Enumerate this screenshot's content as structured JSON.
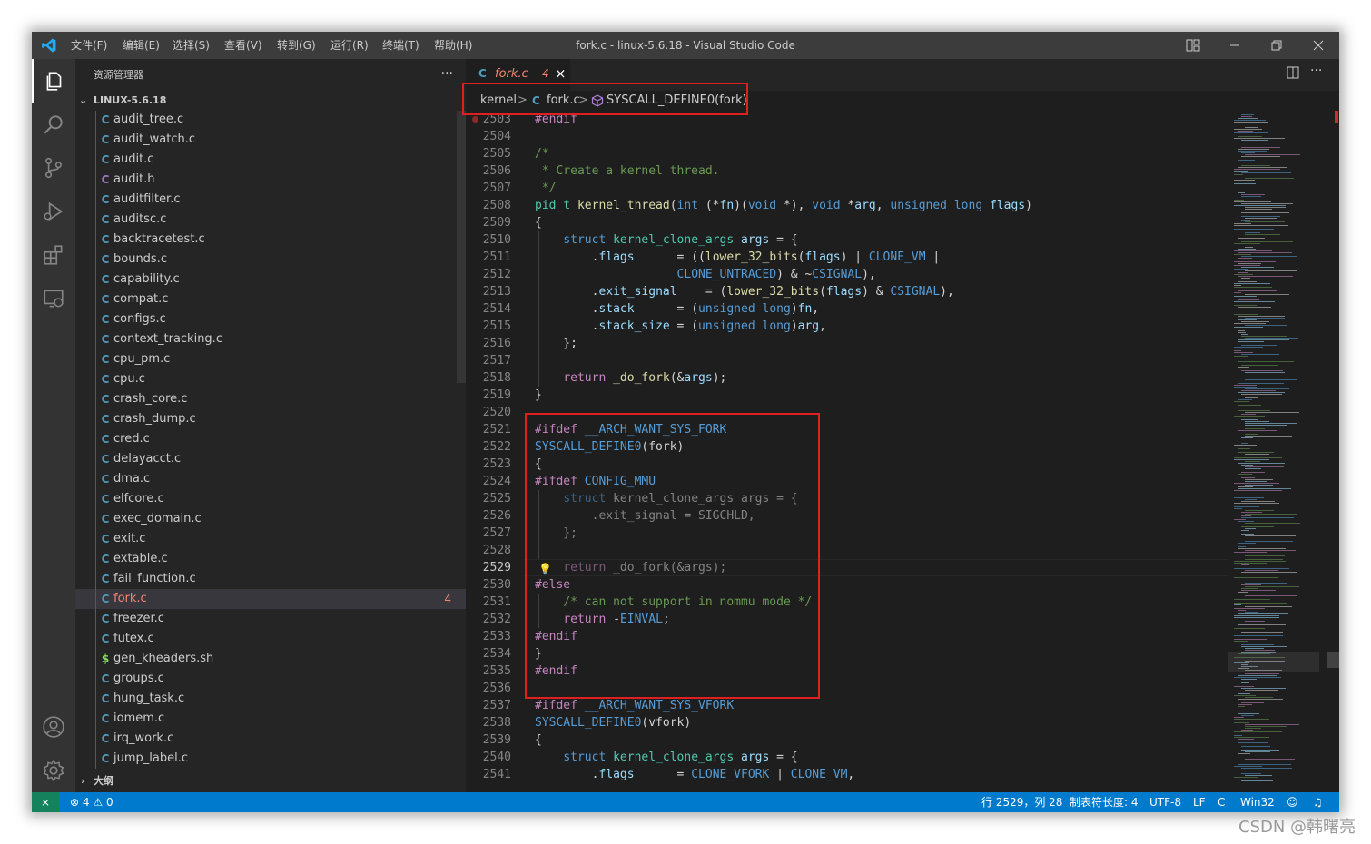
{
  "app": {
    "window_title": "fork.c - linux-5.6.18 - Visual Studio Code",
    "menu": [
      "文件(F)",
      "编辑(E)",
      "选择(S)",
      "查看(V)",
      "转到(G)",
      "运行(R)",
      "终端(T)",
      "帮助(H)"
    ]
  },
  "sidebar": {
    "title": "资源管理器",
    "more": "···",
    "section": "LINUX-5.6.18",
    "outline": "大纲",
    "files": [
      {
        "name": "audit_tree.c",
        "icon": "C",
        "color": "#519aba"
      },
      {
        "name": "audit_watch.c",
        "icon": "C",
        "color": "#519aba"
      },
      {
        "name": "audit.c",
        "icon": "C",
        "color": "#519aba"
      },
      {
        "name": "audit.h",
        "icon": "C",
        "color": "#a074c4"
      },
      {
        "name": "auditfilter.c",
        "icon": "C",
        "color": "#519aba"
      },
      {
        "name": "auditsc.c",
        "icon": "C",
        "color": "#519aba"
      },
      {
        "name": "backtracetest.c",
        "icon": "C",
        "color": "#519aba"
      },
      {
        "name": "bounds.c",
        "icon": "C",
        "color": "#519aba"
      },
      {
        "name": "capability.c",
        "icon": "C",
        "color": "#519aba"
      },
      {
        "name": "compat.c",
        "icon": "C",
        "color": "#519aba"
      },
      {
        "name": "configs.c",
        "icon": "C",
        "color": "#519aba"
      },
      {
        "name": "context_tracking.c",
        "icon": "C",
        "color": "#519aba"
      },
      {
        "name": "cpu_pm.c",
        "icon": "C",
        "color": "#519aba"
      },
      {
        "name": "cpu.c",
        "icon": "C",
        "color": "#519aba"
      },
      {
        "name": "crash_core.c",
        "icon": "C",
        "color": "#519aba"
      },
      {
        "name": "crash_dump.c",
        "icon": "C",
        "color": "#519aba"
      },
      {
        "name": "cred.c",
        "icon": "C",
        "color": "#519aba"
      },
      {
        "name": "delayacct.c",
        "icon": "C",
        "color": "#519aba"
      },
      {
        "name": "dma.c",
        "icon": "C",
        "color": "#519aba"
      },
      {
        "name": "elfcore.c",
        "icon": "C",
        "color": "#519aba"
      },
      {
        "name": "exec_domain.c",
        "icon": "C",
        "color": "#519aba"
      },
      {
        "name": "exit.c",
        "icon": "C",
        "color": "#519aba"
      },
      {
        "name": "extable.c",
        "icon": "C",
        "color": "#519aba"
      },
      {
        "name": "fail_function.c",
        "icon": "C",
        "color": "#519aba"
      },
      {
        "name": "fork.c",
        "icon": "C",
        "color": "#519aba",
        "active": true,
        "badge": "4"
      },
      {
        "name": "freezer.c",
        "icon": "C",
        "color": "#519aba"
      },
      {
        "name": "futex.c",
        "icon": "C",
        "color": "#519aba"
      },
      {
        "name": "gen_kheaders.sh",
        "icon": "$",
        "color": "#89e051"
      },
      {
        "name": "groups.c",
        "icon": "C",
        "color": "#519aba"
      },
      {
        "name": "hung_task.c",
        "icon": "C",
        "color": "#519aba"
      },
      {
        "name": "iomem.c",
        "icon": "C",
        "color": "#519aba"
      },
      {
        "name": "irq_work.c",
        "icon": "C",
        "color": "#519aba"
      },
      {
        "name": "jump_label.c",
        "icon": "C",
        "color": "#519aba"
      }
    ]
  },
  "tab": {
    "icon": "C",
    "name": "fork.c",
    "count": "4",
    "close": "×"
  },
  "breadcrumb": {
    "folder": "kernel",
    "sep": ">",
    "file_icon": "C",
    "file": "fork.c",
    "symbol": "SYSCALL_DEFINE0(fork)"
  },
  "code": [
    {
      "n": "2503",
      "dot": true,
      "s": [
        [
          "#endif",
          "p"
        ]
      ]
    },
    {
      "n": "2504",
      "s": []
    },
    {
      "n": "2505",
      "s": [
        [
          "/*",
          "c"
        ]
      ]
    },
    {
      "n": "2506",
      "s": [
        [
          " * Create a kernel thread.",
          "c"
        ]
      ]
    },
    {
      "n": "2507",
      "s": [
        [
          " */",
          "c"
        ]
      ]
    },
    {
      "n": "2508",
      "s": [
        [
          "pid_t",
          "t"
        ],
        [
          " ",
          "d"
        ],
        [
          "kernel_thread",
          "f"
        ],
        [
          "(",
          "d"
        ],
        [
          "int",
          "k"
        ],
        [
          " (*",
          "d"
        ],
        [
          "fn",
          "v"
        ],
        [
          ")(",
          "d"
        ],
        [
          "void",
          "k"
        ],
        [
          " *), ",
          "d"
        ],
        [
          "void",
          "k"
        ],
        [
          " *",
          "d"
        ],
        [
          "arg",
          "v"
        ],
        [
          ", ",
          "d"
        ],
        [
          "unsigned",
          "k"
        ],
        [
          " ",
          "d"
        ],
        [
          "long",
          "k"
        ],
        [
          " ",
          "d"
        ],
        [
          "flags",
          "v"
        ],
        [
          ")",
          "d"
        ]
      ]
    },
    {
      "n": "2509",
      "s": [
        [
          "{",
          "d"
        ]
      ]
    },
    {
      "n": "2510",
      "s": [
        [
          "    ",
          "d"
        ],
        [
          "struct",
          "k"
        ],
        [
          " ",
          "d"
        ],
        [
          "kernel_clone_args",
          "t"
        ],
        [
          " ",
          "d"
        ],
        [
          "args",
          "v"
        ],
        [
          " = {",
          "d"
        ]
      ]
    },
    {
      "n": "2511",
      "s": [
        [
          "        .",
          "d"
        ],
        [
          "flags",
          "v"
        ],
        [
          "      = ((",
          "d"
        ],
        [
          "lower_32_bits",
          "f"
        ],
        [
          "(",
          "d"
        ],
        [
          "flags",
          "v"
        ],
        [
          ") | ",
          "d"
        ],
        [
          "CLONE_VM",
          "m"
        ],
        [
          " |",
          "d"
        ]
      ]
    },
    {
      "n": "2512",
      "s": [
        [
          "                    ",
          "d"
        ],
        [
          "CLONE_UNTRACED",
          "m"
        ],
        [
          ") & ~",
          "d"
        ],
        [
          "CSIGNAL",
          "m"
        ],
        [
          "),",
          "d"
        ]
      ]
    },
    {
      "n": "2513",
      "s": [
        [
          "        .",
          "d"
        ],
        [
          "exit_signal",
          "v"
        ],
        [
          "    = (",
          "d"
        ],
        [
          "lower_32_bits",
          "f"
        ],
        [
          "(",
          "d"
        ],
        [
          "flags",
          "v"
        ],
        [
          ") & ",
          "d"
        ],
        [
          "CSIGNAL",
          "m"
        ],
        [
          "),",
          "d"
        ]
      ]
    },
    {
      "n": "2514",
      "s": [
        [
          "        .",
          "d"
        ],
        [
          "stack",
          "v"
        ],
        [
          "      = (",
          "d"
        ],
        [
          "unsigned",
          "k"
        ],
        [
          " ",
          "d"
        ],
        [
          "long",
          "k"
        ],
        [
          ")",
          "d"
        ],
        [
          "fn",
          "v"
        ],
        [
          ",",
          "d"
        ]
      ]
    },
    {
      "n": "2515",
      "s": [
        [
          "        .",
          "d"
        ],
        [
          "stack_size",
          "v"
        ],
        [
          " = (",
          "d"
        ],
        [
          "unsigned",
          "k"
        ],
        [
          " ",
          "d"
        ],
        [
          "long",
          "k"
        ],
        [
          ")",
          "d"
        ],
        [
          "arg",
          "v"
        ],
        [
          ",",
          "d"
        ]
      ]
    },
    {
      "n": "2516",
      "s": [
        [
          "    };",
          "d"
        ]
      ]
    },
    {
      "n": "2517",
      "s": []
    },
    {
      "n": "2518",
      "s": [
        [
          "    ",
          "d"
        ],
        [
          "return",
          "p"
        ],
        [
          " ",
          "d"
        ],
        [
          "_do_fork",
          "f"
        ],
        [
          "(&",
          "d"
        ],
        [
          "args",
          "v"
        ],
        [
          ");",
          "d"
        ]
      ]
    },
    {
      "n": "2519",
      "s": [
        [
          "}",
          "d"
        ]
      ]
    },
    {
      "n": "2520",
      "s": []
    },
    {
      "n": "2521",
      "s": [
        [
          "#ifdef",
          "p"
        ],
        [
          " ",
          "d"
        ],
        [
          "__ARCH_WANT_SYS_FORK",
          "m"
        ]
      ]
    },
    {
      "n": "2522",
      "s": [
        [
          "SYSCALL_DEFINE0",
          "m"
        ],
        [
          "(fork)",
          "d"
        ]
      ]
    },
    {
      "n": "2523",
      "s": [
        [
          "{",
          "d"
        ]
      ]
    },
    {
      "n": "2524",
      "s": [
        [
          "#ifdef",
          "p"
        ],
        [
          " ",
          "d"
        ],
        [
          "CONFIG_MMU",
          "m"
        ]
      ]
    },
    {
      "n": "2525",
      "dim": true,
      "s": [
        [
          "    ",
          "d"
        ],
        [
          "struct",
          "k"
        ],
        [
          " kernel_clone_args args = {",
          "d"
        ]
      ]
    },
    {
      "n": "2526",
      "dim": true,
      "s": [
        [
          "        .exit_signal = SIGCHLD,",
          "d"
        ]
      ]
    },
    {
      "n": "2527",
      "dim": true,
      "s": [
        [
          "    };",
          "d"
        ]
      ]
    },
    {
      "n": "2528",
      "s": []
    },
    {
      "n": "2529",
      "cur": true,
      "bulb": true,
      "dim": true,
      "s": [
        [
          "    ",
          "d"
        ],
        [
          "return",
          "p"
        ],
        [
          " _do_fork(&args);",
          "d"
        ]
      ]
    },
    {
      "n": "2530",
      "s": [
        [
          "#else",
          "p"
        ]
      ]
    },
    {
      "n": "2531",
      "s": [
        [
          "    ",
          "d"
        ],
        [
          "/* can not support in nommu mode */",
          "c"
        ]
      ]
    },
    {
      "n": "2532",
      "s": [
        [
          "    ",
          "d"
        ],
        [
          "return",
          "p"
        ],
        [
          " -",
          "d"
        ],
        [
          "EINVAL",
          "m"
        ],
        [
          ";",
          "d"
        ]
      ]
    },
    {
      "n": "2533",
      "s": [
        [
          "#endif",
          "p"
        ]
      ]
    },
    {
      "n": "2534",
      "s": [
        [
          "}",
          "d"
        ]
      ]
    },
    {
      "n": "2535",
      "s": [
        [
          "#endif",
          "p"
        ]
      ]
    },
    {
      "n": "2536",
      "s": []
    },
    {
      "n": "2537",
      "s": [
        [
          "#ifdef",
          "p"
        ],
        [
          " ",
          "d"
        ],
        [
          "__ARCH_WANT_SYS_VFORK",
          "m"
        ]
      ]
    },
    {
      "n": "2538",
      "s": [
        [
          "SYSCALL_DEFINE0",
          "m"
        ],
        [
          "(vfork)",
          "d"
        ]
      ]
    },
    {
      "n": "2539",
      "s": [
        [
          "{",
          "d"
        ]
      ]
    },
    {
      "n": "2540",
      "s": [
        [
          "    ",
          "d"
        ],
        [
          "struct",
          "k"
        ],
        [
          " ",
          "d"
        ],
        [
          "kernel_clone_args",
          "t"
        ],
        [
          " ",
          "d"
        ],
        [
          "args",
          "v"
        ],
        [
          " = {",
          "d"
        ]
      ]
    },
    {
      "n": "2541",
      "s": [
        [
          "        .",
          "d"
        ],
        [
          "flags",
          "v"
        ],
        [
          "      = ",
          "d"
        ],
        [
          "CLONE_VFORK",
          "m"
        ],
        [
          " | ",
          "d"
        ],
        [
          "CLONE_VM",
          "m"
        ],
        [
          ",",
          "d"
        ]
      ]
    }
  ],
  "status": {
    "errors": "4",
    "warnings": "0",
    "position": "行 2529，列 28",
    "indent": "制表符长度: 4",
    "encoding": "UTF-8",
    "eol": "LF",
    "language": "C",
    "platform": "Win32"
  },
  "watermark": "CSDN @韩曙亮",
  "colors": {
    "accent": "#007acc",
    "highlight_box": "#e02020",
    "error": "#f48771"
  }
}
